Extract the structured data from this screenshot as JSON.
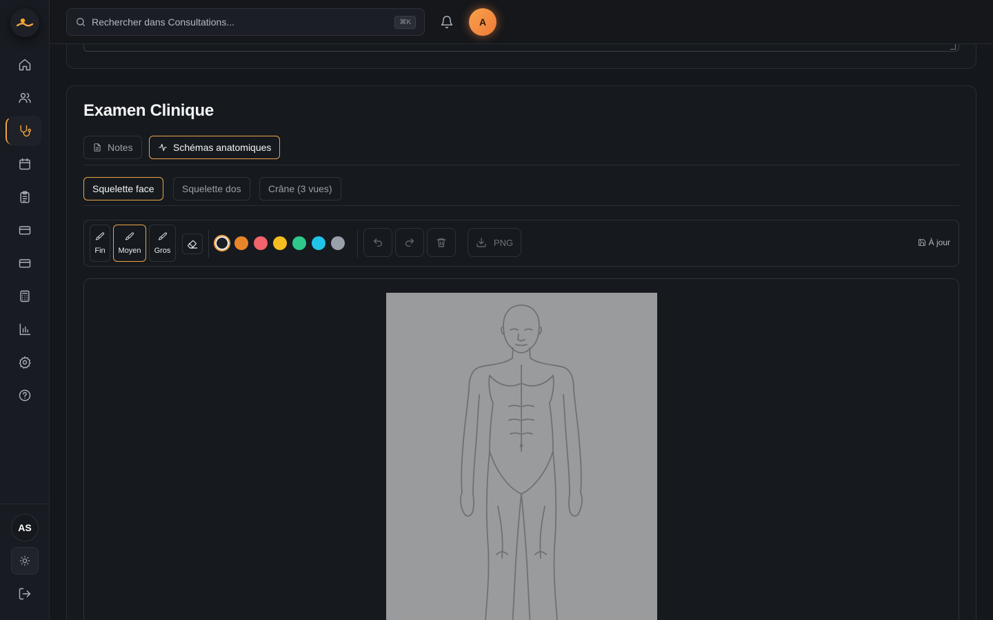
{
  "search": {
    "placeholder": "Rechercher dans Consultations...",
    "shortcut": "⌘K"
  },
  "user": {
    "initial": "A",
    "sidebar_initials": "AS"
  },
  "sidebar": {
    "items": [
      {
        "name": "home-icon"
      },
      {
        "name": "users-icon"
      },
      {
        "name": "stethoscope-icon",
        "active": true
      },
      {
        "name": "calendar-icon"
      },
      {
        "name": "clipboard-icon"
      },
      {
        "name": "credit-card-icon"
      },
      {
        "name": "credit-card-icon"
      },
      {
        "name": "calculator-icon"
      },
      {
        "name": "bar-chart-icon"
      },
      {
        "name": "settings-icon"
      },
      {
        "name": "help-icon"
      }
    ]
  },
  "exam": {
    "title": "Examen Clinique",
    "tabs": [
      {
        "label": "Notes",
        "icon": "file-text-icon"
      },
      {
        "label": "Schémas anatomiques",
        "icon": "activity-icon",
        "active": true
      }
    ],
    "subtabs": [
      {
        "label": "Squelette face",
        "active": true
      },
      {
        "label": "Squelette dos"
      },
      {
        "label": "Crâne (3 vues)"
      }
    ],
    "toolbar": {
      "brushes": [
        {
          "label": "Fin"
        },
        {
          "label": "Moyen",
          "active": true
        },
        {
          "label": "Gros"
        }
      ],
      "colors": [
        "#1b1e24",
        "#e8852b",
        "#f2636b",
        "#f5bd1f",
        "#2ec98a",
        "#1fc4e8",
        "#9aa0aa"
      ],
      "selected_color": "#1b1e24",
      "export_label": "PNG",
      "status": "À jour"
    }
  },
  "colors": {
    "accent": "#f0a545",
    "background": "#14171c",
    "canvas": "#9a9b9c"
  }
}
